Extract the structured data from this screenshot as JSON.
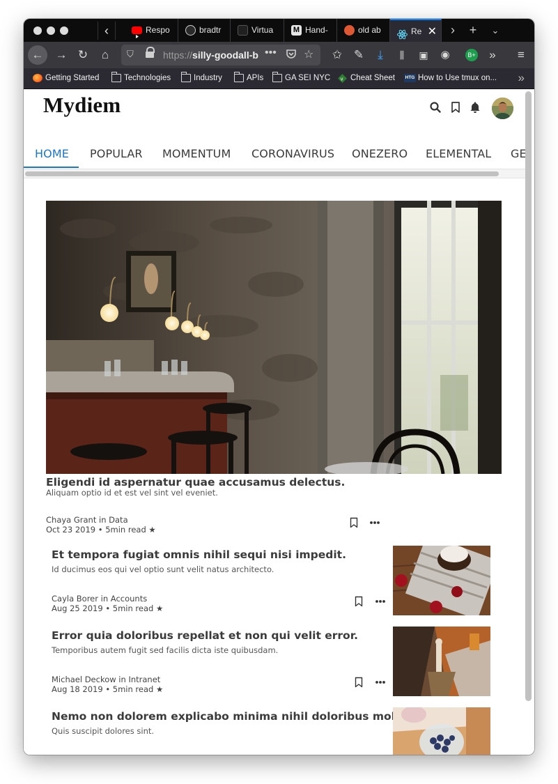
{
  "browser": {
    "tabs": [
      {
        "label": "Respo",
        "favicon": "youtube-icon",
        "color": "#ff0000"
      },
      {
        "label": "bradtr",
        "favicon": "github-icon",
        "color": "#ffffff"
      },
      {
        "label": "Virtua",
        "favicon": "app-icon",
        "color": "#333333"
      },
      {
        "label": "Hand-",
        "favicon": "m-icon",
        "color": "#dddddd"
      },
      {
        "label": "old ab",
        "favicon": "duckduckgo-icon",
        "color": "#de5833"
      },
      {
        "label": "Re",
        "favicon": "react-icon",
        "color": "#61dafb"
      }
    ],
    "url_prefix": "https://",
    "url_host": "silly-goodall-b",
    "addon_badge": "B+",
    "bookmarks": [
      {
        "label": "Getting Started",
        "icon": "firefox-icon"
      },
      {
        "label": "Technologies",
        "icon": "folder-icon"
      },
      {
        "label": "Industry",
        "icon": "folder-icon"
      },
      {
        "label": "APIs",
        "icon": "folder-icon"
      },
      {
        "label": "GA SEI NYC",
        "icon": "folder-icon"
      },
      {
        "label": "Cheat Sheet",
        "icon": "vim-icon"
      },
      {
        "label": "How to Use tmux on...",
        "icon": "htg-icon"
      }
    ]
  },
  "site": {
    "logo": "Mydiem",
    "nav": [
      "HOME",
      "POPULAR",
      "MOMENTUM",
      "CORONAVIRUS",
      "ONEZERO",
      "ELEMENTAL",
      "GE"
    ],
    "accent": "#1976d2"
  },
  "hero": {
    "title": "Eligendi id aspernatur quae accusamus delectus.",
    "subtitle": "Aliquam optio id et est vel sint vel eveniet.",
    "author_line": "Chaya Grant in Data",
    "date_line": "Oct 23 2019 • 5min read ★"
  },
  "articles": [
    {
      "title": "Et tempora fugiat omnis nihil sequi nisi impedit.",
      "subtitle": "Id ducimus eos qui vel optio sunt velit natus architecto.",
      "author_line": "Cayla Borer in Accounts",
      "date_line": "Aug 25 2019 • 5min read ★"
    },
    {
      "title": "Error quia doloribus repellat et non qui velit error.",
      "subtitle": "Temporibus autem fugit sed facilis dicta iste quibusdam.",
      "author_line": "Michael Deckow in Intranet",
      "date_line": "Aug 18 2019 • 5min read ★"
    },
    {
      "title": "Nemo non dolorem explicabo minima nihil doloribus mollitia.",
      "subtitle": "Quis suscipit dolores sint."
    }
  ]
}
